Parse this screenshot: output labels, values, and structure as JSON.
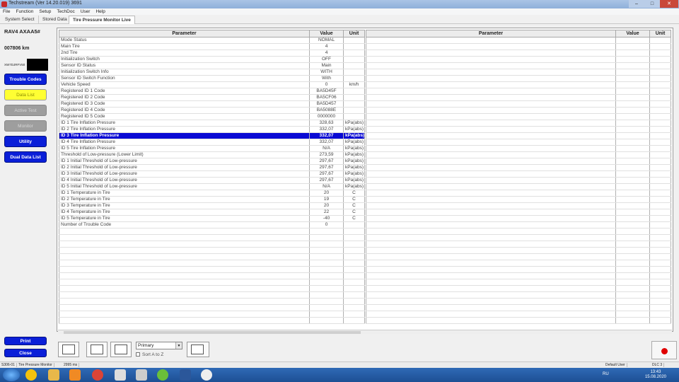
{
  "window": {
    "title": "Techstream (Ver 14.20.019)   3691",
    "min": "–",
    "max": "□",
    "close": "✕"
  },
  "menu": [
    "File",
    "Function",
    "Setup",
    "TechDoc",
    "User",
    "Help"
  ],
  "tabs": [
    "System Select",
    "Stored Data",
    "Tire Pressure Monitor Live"
  ],
  "vehicle": {
    "model": "RAV4 AXAA5#",
    "odometer": "007806 km",
    "vin": "XW7DJRFV50"
  },
  "sidebar": {
    "trouble_codes": "Trouble Codes",
    "data_list": "Data List",
    "active_test": "Active Test",
    "monitor": "Monitor",
    "utility": "Utility",
    "dual_data_list": "Dual Data List",
    "print": "Print",
    "close": "Close"
  },
  "table": {
    "headers": {
      "parameter": "Parameter",
      "value": "Value",
      "unit": "Unit"
    },
    "rows": [
      [
        "Mode Status",
        "NOMAL",
        ""
      ],
      [
        "Main Tire",
        "4",
        ""
      ],
      [
        "2nd Tire",
        "4",
        ""
      ],
      [
        "Initialization Switch",
        "OFF",
        ""
      ],
      [
        "Sensor ID Status",
        "Main",
        ""
      ],
      [
        "Initialization Switch Info",
        "WITH",
        ""
      ],
      [
        "Sensor ID Switch Function",
        "With",
        ""
      ],
      [
        "Vehicle Speed",
        "0",
        "km/h"
      ],
      [
        "Registered ID 1 Code",
        "BA5D45F",
        ""
      ],
      [
        "Registered ID 2 Code",
        "BA5CF06",
        ""
      ],
      [
        "Registered ID 3 Code",
        "BA5D457",
        ""
      ],
      [
        "Registered ID 4 Code",
        "BA5088E",
        ""
      ],
      [
        "Registered ID 5 Code",
        "0000000",
        ""
      ],
      [
        "ID 1 Tire Inflation Pressure",
        "328,63",
        "kPa(abs)"
      ],
      [
        "ID 2 Tire Inflation Pressure",
        "332,07",
        "kPa(abs)"
      ],
      [
        "ID 3 Tire Inflation Pressure",
        "332,07",
        "kPa(abs)"
      ],
      [
        "ID 4 Tire Inflation Pressure",
        "332,07",
        "kPa(abs)"
      ],
      [
        "ID 5 Tire Inflation Pressure",
        "N/A",
        "kPa(abs)"
      ],
      [
        "Threshold of Low-pressure (Lower Limit)",
        "273,59",
        "kPa(abs)"
      ],
      [
        "ID 1 Initial Threshold of Low-pressure",
        "297,67",
        "kPa(abs)"
      ],
      [
        "ID 2 Initial Threshold of Low-pressure",
        "297,67",
        "kPa(abs)"
      ],
      [
        "ID 3 Initial Threshold of Low-pressure",
        "297,67",
        "kPa(abs)"
      ],
      [
        "ID 4 Initial Threshold of Low-pressure",
        "297,67",
        "kPa(abs)"
      ],
      [
        "ID 5 Initial Threshold of Low-pressure",
        "N/A",
        "kPa(abs)"
      ],
      [
        "ID 1 Temperature in Tire",
        "20",
        "C"
      ],
      [
        "ID 2 Temperature in Tire",
        "19",
        "C"
      ],
      [
        "ID 3 Temperature in Tire",
        "20",
        "C"
      ],
      [
        "ID 4 Temperature in Tire",
        "22",
        "C"
      ],
      [
        "ID 5 Temperature in Tire",
        "-40",
        "C"
      ],
      [
        "Number of Trouble Code",
        "0",
        ""
      ]
    ],
    "selected_row": 15
  },
  "toolbar": {
    "combo_value": "Primary",
    "sort_label": "Sort A to Z"
  },
  "statusbar": {
    "code": "S306-01",
    "screen": "Tire Pressure Monitor",
    "time": "2995 ms",
    "user": "Default User",
    "dlc": "DLC 3"
  },
  "taskbar": {
    "lang": "RU",
    "time": "13:43",
    "date": "15.08.2020"
  },
  "colors": {
    "selected_row": "#0a0ad4",
    "sidebar_button": "#0a1fd8",
    "data_list_button": "#ffff33",
    "titlebar": "#a9c4e6"
  }
}
